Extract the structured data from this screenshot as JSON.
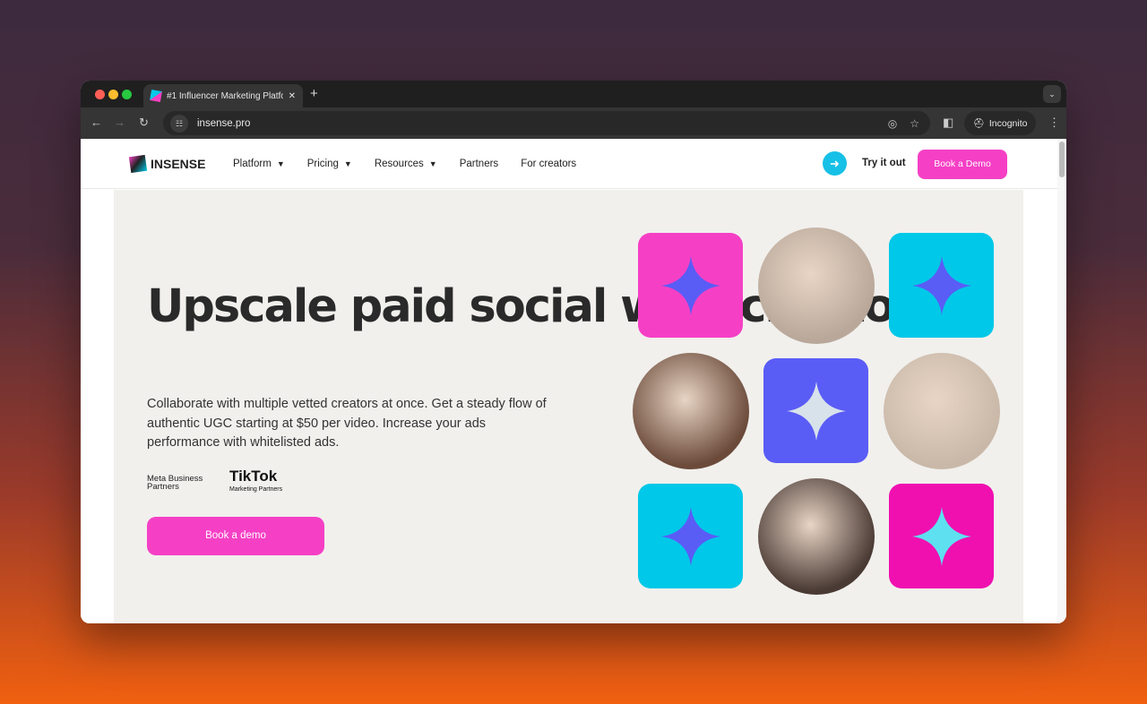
{
  "browser": {
    "tab_title": "#1 Influencer Marketing Platfo",
    "url": "insense.pro",
    "profile": "Incognito"
  },
  "nav": {
    "brand": "INSENSE",
    "items": [
      {
        "label": "Platform",
        "dropdown": true
      },
      {
        "label": "Pricing",
        "dropdown": true
      },
      {
        "label": "Resources",
        "dropdown": true
      },
      {
        "label": "Partners",
        "dropdown": false
      },
      {
        "label": "For creators",
        "dropdown": false
      }
    ],
    "try": "Try it out",
    "book": "Book a Demo"
  },
  "hero": {
    "title": "Upscale paid social with creators",
    "subtitle": "Collaborate with multiple vetted creators at once. Get a steady flow of authentic UGC starting at $50 per video. Increase your ads performance with whitelisted ads.",
    "meta_partner": "Meta Business Partners",
    "tiktok": "TikTok",
    "tiktok_sub": "Marketing Partners",
    "cta": "Book a demo"
  },
  "colors": {
    "pink": "#f540c5",
    "cyan": "#00c8e8",
    "blue": "#5a5cf6",
    "magenta": "#f010b0"
  }
}
